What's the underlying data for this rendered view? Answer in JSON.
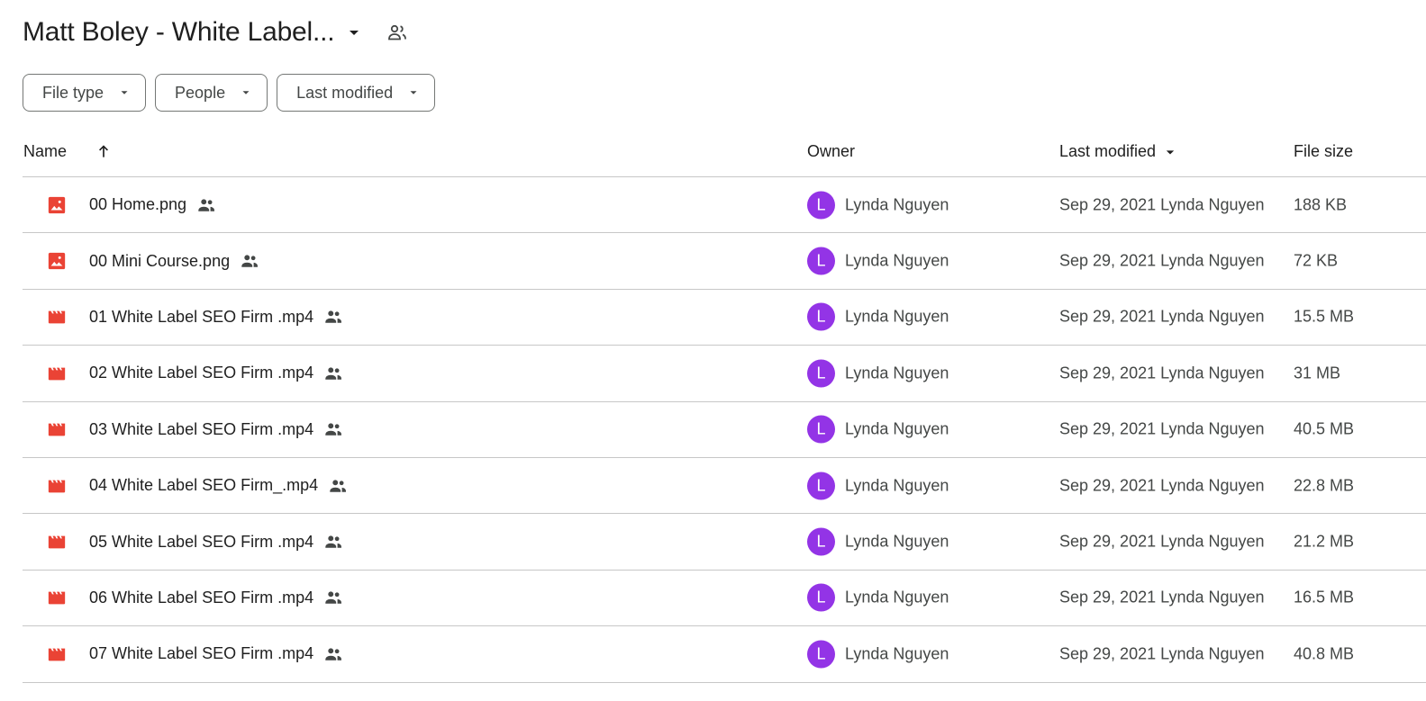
{
  "header": {
    "title": "Matt Boley - White Label...",
    "caret_icon": "arrow-drop-down-icon",
    "shared_icon": "shared-folder-people-icon"
  },
  "filters": [
    {
      "label": "File type"
    },
    {
      "label": "People"
    },
    {
      "label": "Last modified"
    }
  ],
  "columns": {
    "name": "Name",
    "owner": "Owner",
    "last_modified": "Last modified",
    "file_size": "File size",
    "sort_icon": "arrow-upward-icon"
  },
  "colors": {
    "file_icon_red": "#ea4335",
    "avatar_purple": "#9334e6",
    "divider": "#c7c7c7",
    "muted_text": "#444746"
  },
  "files": [
    {
      "name": "00 Home.png",
      "type": "image",
      "owner": "Lynda Nguyen",
      "owner_initial": "L",
      "modified": "Sep 29, 2021 Lynda Nguyen",
      "size": "188 KB"
    },
    {
      "name": "00 Mini Course.png",
      "type": "image",
      "owner": "Lynda Nguyen",
      "owner_initial": "L",
      "modified": "Sep 29, 2021 Lynda Nguyen",
      "size": "72 KB"
    },
    {
      "name": "01 White Label SEO Firm .mp4",
      "type": "video",
      "owner": "Lynda Nguyen",
      "owner_initial": "L",
      "modified": "Sep 29, 2021 Lynda Nguyen",
      "size": "15.5 MB"
    },
    {
      "name": "02 White Label SEO Firm .mp4",
      "type": "video",
      "owner": "Lynda Nguyen",
      "owner_initial": "L",
      "modified": "Sep 29, 2021 Lynda Nguyen",
      "size": "31 MB"
    },
    {
      "name": "03 White Label SEO Firm .mp4",
      "type": "video",
      "owner": "Lynda Nguyen",
      "owner_initial": "L",
      "modified": "Sep 29, 2021 Lynda Nguyen",
      "size": "40.5 MB"
    },
    {
      "name": "04 White Label SEO Firm_.mp4",
      "type": "video",
      "owner": "Lynda Nguyen",
      "owner_initial": "L",
      "modified": "Sep 29, 2021 Lynda Nguyen",
      "size": "22.8 MB"
    },
    {
      "name": "05 White Label SEO Firm .mp4",
      "type": "video",
      "owner": "Lynda Nguyen",
      "owner_initial": "L",
      "modified": "Sep 29, 2021 Lynda Nguyen",
      "size": "21.2 MB"
    },
    {
      "name": "06 White Label SEO Firm .mp4",
      "type": "video",
      "owner": "Lynda Nguyen",
      "owner_initial": "L",
      "modified": "Sep 29, 2021 Lynda Nguyen",
      "size": "16.5 MB"
    },
    {
      "name": "07 White Label SEO Firm .mp4",
      "type": "video",
      "owner": "Lynda Nguyen",
      "owner_initial": "L",
      "modified": "Sep 29, 2021 Lynda Nguyen",
      "size": "40.8 MB"
    }
  ]
}
